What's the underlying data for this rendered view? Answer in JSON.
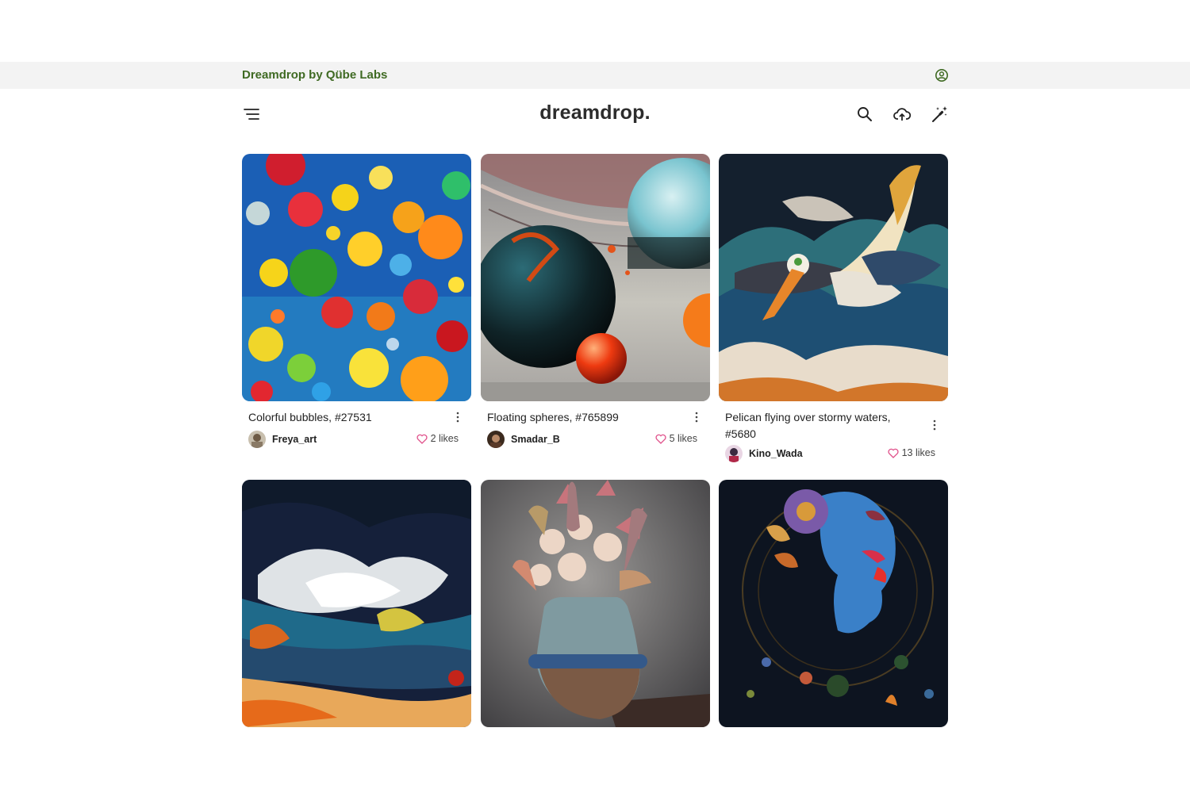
{
  "topbar": {
    "brand": "Dreamdrop by Qübe Labs",
    "account_icon": "account-circle-icon"
  },
  "header": {
    "logo": "dreamdrop.",
    "menu_icon": "menu-icon",
    "search_icon": "search-icon",
    "upload_icon": "cloud-upload-icon",
    "create_icon": "magic-wand-icon"
  },
  "colors": {
    "brand": "#3f6a23",
    "like_heart": "#e0508a"
  },
  "posts": [
    {
      "title": "Colorful bubbles, #27531",
      "user": "Freya_art",
      "likes": "2 likes"
    },
    {
      "title": "Floating spheres, #765899",
      "user": "Smadar_B",
      "likes": "5 likes"
    },
    {
      "title": "Pelican flying over stormy waters, #5680",
      "user": "Kino_Wada",
      "likes": "13 likes"
    },
    {
      "title": "",
      "user": "",
      "likes": ""
    },
    {
      "title": "",
      "user": "",
      "likes": ""
    },
    {
      "title": "",
      "user": "",
      "likes": ""
    }
  ]
}
